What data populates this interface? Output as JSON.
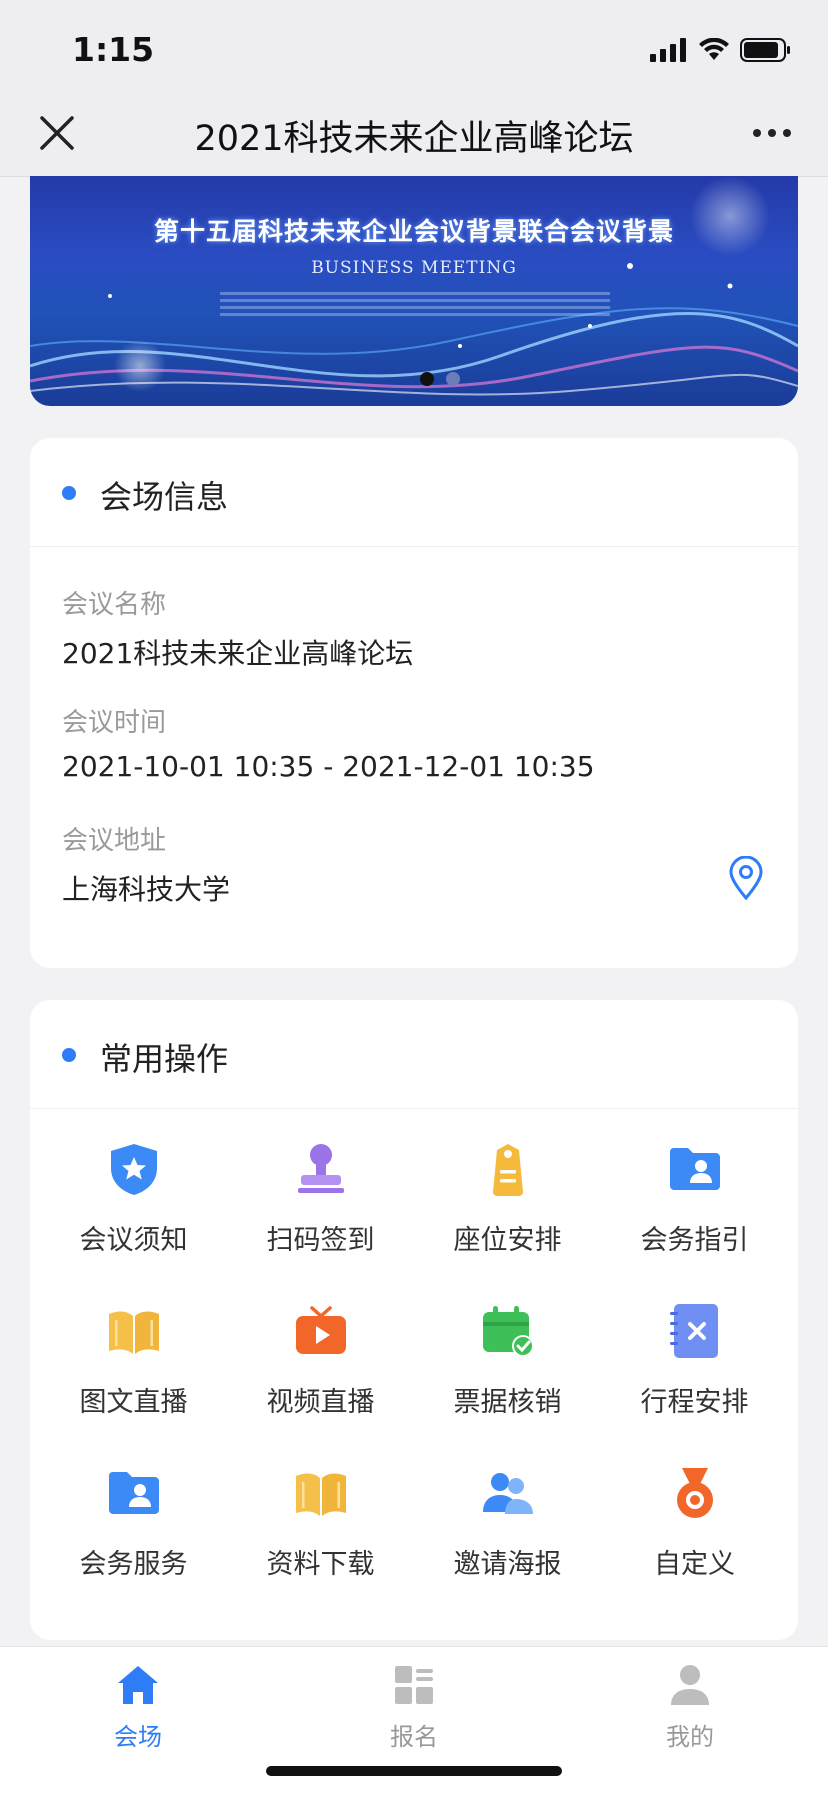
{
  "status_bar": {
    "time": "1:15"
  },
  "nav": {
    "title": "2021科技未来企业高峰论坛",
    "close_icon": "close-icon",
    "more_icon": "more-icon"
  },
  "banner": {
    "title": "第十五届科技未来企业会议背景联合会议背景",
    "subtitle": "BUSINESS MEETING",
    "slides": 2,
    "active_slide": 1
  },
  "venue": {
    "section_title": "会场信息",
    "fields": [
      {
        "label": "会议名称",
        "value": "2021科技未来企业高峰论坛"
      },
      {
        "label": "会议时间",
        "value": "2021-10-01 10:35 - 2021-12-01 10:35"
      },
      {
        "label": "会议地址",
        "value": "上海科技大学"
      }
    ],
    "location_icon": "location-pin-icon"
  },
  "operations": {
    "section_title": "常用操作",
    "items": [
      {
        "label": "会议须知",
        "icon": "shield-star-icon"
      },
      {
        "label": "扫码签到",
        "icon": "stamp-icon"
      },
      {
        "label": "座位安排",
        "icon": "tag-icon"
      },
      {
        "label": "会务指引",
        "icon": "folder-user-icon"
      },
      {
        "label": "图文直播",
        "icon": "open-book-icon"
      },
      {
        "label": "视频直播",
        "icon": "tv-play-icon"
      },
      {
        "label": "票据核销",
        "icon": "calendar-check-icon"
      },
      {
        "label": "行程安排",
        "icon": "notebook-x-icon"
      },
      {
        "label": "会务服务",
        "icon": "folder-user-icon"
      },
      {
        "label": "资料下载",
        "icon": "open-book-icon"
      },
      {
        "label": "邀请海报",
        "icon": "users-icon"
      },
      {
        "label": "自定义",
        "icon": "medal-icon"
      }
    ]
  },
  "tabbar": {
    "tabs": [
      {
        "label": "会场",
        "icon": "home-icon",
        "active": true
      },
      {
        "label": "报名",
        "icon": "grid-list-icon",
        "active": false
      },
      {
        "label": "我的",
        "icon": "user-icon",
        "active": false
      }
    ]
  },
  "colors": {
    "accent": "#2f7df6",
    "background": "#f2f2f5"
  }
}
